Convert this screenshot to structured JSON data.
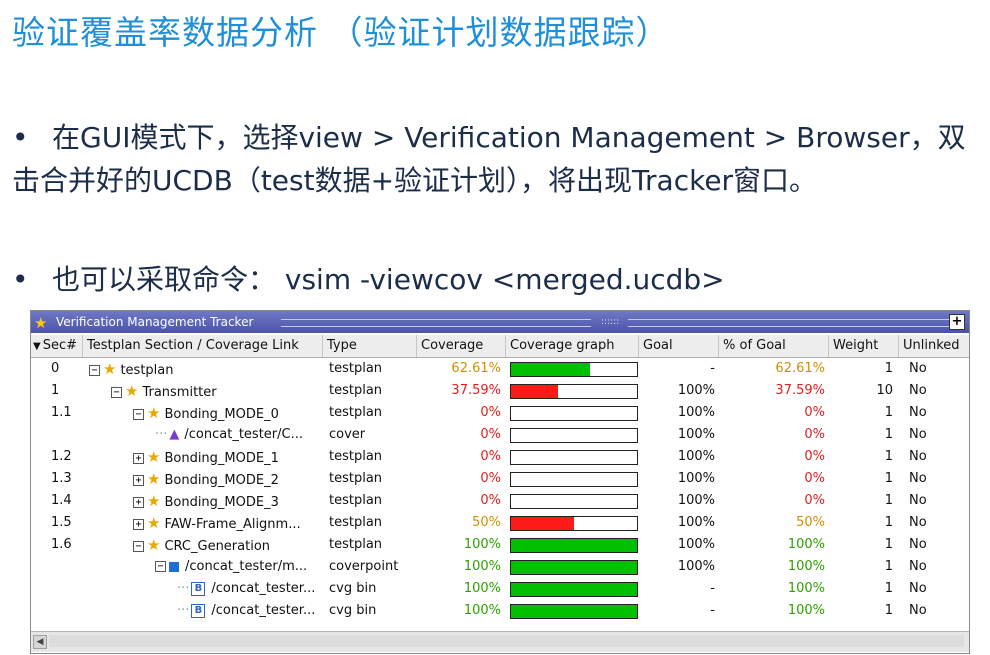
{
  "slide": {
    "title": "验证覆盖率数据分析  （验证计划数据跟踪）",
    "bullet1": "在GUI模式下，选择view > Verification Management > Browser，双击合并好的UCDB（test数据+验证计划），将出现Tracker窗口。",
    "bullet2": "也可以采取命令：  vsim -viewcov <merged.ucdb>",
    "bullet_mark": "•"
  },
  "window": {
    "title": "Verification Management Tracker",
    "maximize_label": "+",
    "grip_label": "::::::"
  },
  "columns": {
    "sec": "Sec#",
    "section": "Testplan Section / Coverage Link",
    "type": "Type",
    "coverage": "Coverage",
    "graph": "Coverage graph",
    "goal": "Goal",
    "pct_goal": "% of Goal",
    "weight": "Weight",
    "unlinked": "Unlinked"
  },
  "sort_indicator": "▼",
  "colors": {
    "green": "#00c000",
    "red": "#ff1a1a",
    "pct_orange": "#d09000",
    "pct_red": "#e02020",
    "pct_green": "#30a000",
    "title_blue": "#1f8fd8"
  },
  "rows": [
    {
      "sec": "0",
      "depth": 0,
      "expander": "−",
      "icon": "star",
      "name": "testplan",
      "type": "testplan",
      "coverage": "62.61%",
      "value": 62.61,
      "status": "orange",
      "goal": "-",
      "pct_goal": "62.61%",
      "weight": "1",
      "unlinked": "No"
    },
    {
      "sec": "1",
      "depth": 1,
      "expander": "−",
      "icon": "star",
      "name": "Transmitter",
      "type": "testplan",
      "coverage": "37.59%",
      "value": 37.59,
      "status": "red",
      "goal": "100%",
      "pct_goal": "37.59%",
      "weight": "10",
      "unlinked": "No"
    },
    {
      "sec": "1.1",
      "depth": 2,
      "expander": "−",
      "icon": "star",
      "name": "Bonding_MODE_0",
      "type": "testplan",
      "coverage": "0%",
      "value": 0,
      "status": "red",
      "goal": "100%",
      "pct_goal": "0%",
      "weight": "1",
      "unlinked": "No"
    },
    {
      "sec": "",
      "depth": 3,
      "expander": "",
      "icon": "cover",
      "name": "/concat_tester/C...",
      "type": "cover",
      "coverage": "0%",
      "value": 0,
      "status": "red",
      "goal": "100%",
      "pct_goal": "0%",
      "weight": "1",
      "unlinked": "No"
    },
    {
      "sec": "1.2",
      "depth": 2,
      "expander": "+",
      "icon": "star",
      "name": "Bonding_MODE_1",
      "type": "testplan",
      "coverage": "0%",
      "value": 0,
      "status": "red",
      "goal": "100%",
      "pct_goal": "0%",
      "weight": "1",
      "unlinked": "No"
    },
    {
      "sec": "1.3",
      "depth": 2,
      "expander": "+",
      "icon": "star",
      "name": "Bonding_MODE_2",
      "type": "testplan",
      "coverage": "0%",
      "value": 0,
      "status": "red",
      "goal": "100%",
      "pct_goal": "0%",
      "weight": "1",
      "unlinked": "No"
    },
    {
      "sec": "1.4",
      "depth": 2,
      "expander": "+",
      "icon": "star",
      "name": "Bonding_MODE_3",
      "type": "testplan",
      "coverage": "0%",
      "value": 0,
      "status": "red",
      "goal": "100%",
      "pct_goal": "0%",
      "weight": "1",
      "unlinked": "No"
    },
    {
      "sec": "1.5",
      "depth": 2,
      "expander": "+",
      "icon": "star",
      "name": "FAW-Frame_Alignm...",
      "type": "testplan",
      "coverage": "50%",
      "value": 50,
      "status": "orange",
      "goal": "100%",
      "pct_goal": "50%",
      "weight": "1",
      "unlinked": "No"
    },
    {
      "sec": "1.6",
      "depth": 2,
      "expander": "−",
      "icon": "star",
      "name": "CRC_Generation",
      "type": "testplan",
      "coverage": "100%",
      "value": 100,
      "status": "green",
      "goal": "100%",
      "pct_goal": "100%",
      "weight": "1",
      "unlinked": "No"
    },
    {
      "sec": "",
      "depth": 3,
      "expander": "−",
      "icon": "coverpoint",
      "name": "/concat_tester/m...",
      "type": "coverpoint",
      "coverage": "100%",
      "value": 100,
      "status": "green",
      "goal": "100%",
      "pct_goal": "100%",
      "weight": "1",
      "unlinked": "No"
    },
    {
      "sec": "",
      "depth": 4,
      "expander": "",
      "icon": "bin",
      "name": "/concat_tester...",
      "type": "cvg bin",
      "coverage": "100%",
      "value": 100,
      "status": "green",
      "goal": "-",
      "pct_goal": "100%",
      "weight": "1",
      "unlinked": "No"
    },
    {
      "sec": "",
      "depth": 4,
      "expander": "",
      "icon": "bin",
      "name": "/concat_tester...",
      "type": "cvg bin",
      "coverage": "100%",
      "value": 100,
      "status": "green",
      "goal": "-",
      "pct_goal": "100%",
      "weight": "1",
      "unlinked": "No"
    }
  ],
  "icons": {
    "star": "star-icon",
    "cover": "cover-icon",
    "coverpoint": "coverpoint-icon",
    "bin": "bin-icon",
    "bin_letter": "B",
    "scroll_left": "◀"
  }
}
